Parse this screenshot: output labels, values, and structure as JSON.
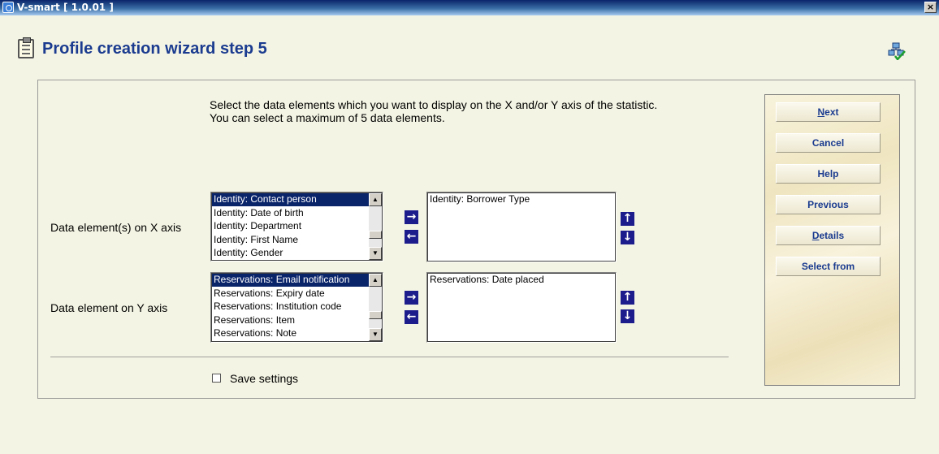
{
  "window": {
    "title": "V-smart [ 1.0.01 ]",
    "close_glyph": "×"
  },
  "page": {
    "title": "Profile creation wizard step 5"
  },
  "instructions": {
    "line1": "Select the data elements which you want to display on the X and/or Y axis of the statistic.",
    "line2": "You can select a maximum of 5 data elements."
  },
  "x_axis": {
    "label": "Data element(s) on X axis",
    "available": [
      "Identity: Contact person",
      "Identity: Date of birth",
      "Identity: Department",
      "Identity: First Name",
      "Identity: Gender"
    ],
    "selected_index": 0,
    "chosen": [
      "Identity: Borrower Type"
    ]
  },
  "y_axis": {
    "label": "Data element on Y axis",
    "available": [
      "Reservations: Email notification",
      "Reservations: Expiry date",
      "Reservations: Institution code",
      "Reservations: Item",
      "Reservations: Note"
    ],
    "selected_index": 0,
    "chosen": [
      "Reservations: Date placed"
    ]
  },
  "glyphs": {
    "add": "→",
    "remove": "←",
    "up": "↑",
    "down": "↓",
    "scroll_up": "▲",
    "scroll_down": "▼"
  },
  "save_settings": {
    "label": "Save settings",
    "checked": false
  },
  "buttons": {
    "next_u": "N",
    "next_rest": "ext",
    "cancel": "Cancel",
    "help": "Help",
    "previous": "Previous",
    "details_u": "D",
    "details_rest": "etails",
    "select_from": "Select from"
  },
  "icons": {
    "app": "ie-icon",
    "header": "clipboard-icon",
    "tree": "tree-check-icon"
  },
  "colors": {
    "title": "#1a3b8f",
    "selection": "#0a246a",
    "arrow_button": "#1c1c8c"
  }
}
